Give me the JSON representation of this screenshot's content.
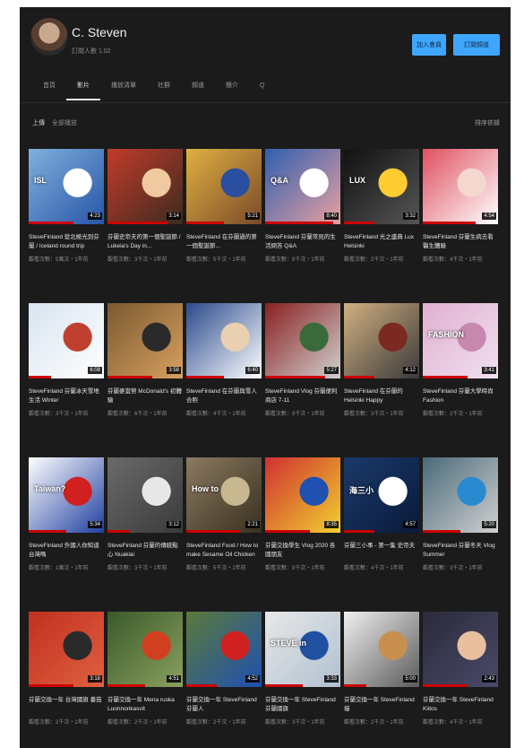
{
  "channel": {
    "name": "C. Steven",
    "subscribers": "訂閱人數 1.02",
    "join_button": "加入會員",
    "subscribe_button": "訂閱頻道"
  },
  "tabs": [
    {
      "label": "首頁"
    },
    {
      "label": "影片"
    },
    {
      "label": "播放清單"
    },
    {
      "label": "社群"
    },
    {
      "label": "頻道"
    },
    {
      "label": "簡介"
    },
    {
      "label": "Q"
    }
  ],
  "toolbar": {
    "left": "上傳",
    "left_sub": "全部播放",
    "right": "排序依據"
  },
  "videos": [
    {
      "title": "SteveFinland 從北極光到芬蘭 / Iceland round trip",
      "meta": "觀看次數：5萬次・1年前",
      "duration": "4:23",
      "progress": 0.6,
      "colors": [
        "#7fb0dc",
        "#ffffff",
        "#2855a8"
      ],
      "label": "ISL"
    },
    {
      "title": "芬蘭史帝夫的第一個聖誕節 / Lukeia's Day in...",
      "meta": "觀看次數：3千次・1年前",
      "duration": "3:14",
      "progress": 0.8,
      "colors": [
        "#c23b2a",
        "#f0c9a0",
        "#3b2b20"
      ],
      "label": ""
    },
    {
      "title": "SteveFinland 在芬蘭過的第一個聖誕節...",
      "meta": "觀看次數：5千次・1年前",
      "duration": "5:21",
      "progress": 0.5,
      "colors": [
        "#e0b040",
        "#2a4ea0",
        "#7a4a2a"
      ],
      "label": ""
    },
    {
      "title": "SteveFinland 芬蘭常見的生活問答 Q&A",
      "meta": "觀看次數：8千次・1年前",
      "duration": "8:40",
      "progress": 0.9,
      "colors": [
        "#2f5fb0",
        "#ffffff",
        "#e8a0a0"
      ],
      "label": "Q&A"
    },
    {
      "title": "SteveFinland 光之盛典 Lux Helsinki",
      "meta": "觀看次數：2千次・1年前",
      "duration": "3:32",
      "progress": 0.4,
      "colors": [
        "#111111",
        "#ffcc33",
        "#555555"
      ],
      "label": "LUX"
    },
    {
      "title": "SteveFinland 芬蘭生病去看醫生體驗",
      "meta": "觀看次數：4千次・1年前",
      "duration": "4:54",
      "progress": 0.7,
      "colors": [
        "#e05060",
        "#f4d8d0",
        "#ffffff"
      ],
      "label": ""
    },
    {
      "title": "SteveFinland 芬蘭冰天雪地生活 Winter",
      "meta": "觀看次數：3千次・1年前",
      "duration": "6:08",
      "progress": 0.3,
      "colors": [
        "#d8e4f0",
        "#c04030",
        "#ffffff"
      ],
      "label": ""
    },
    {
      "title": "芬蘭麥當勞 McDonald's 初體驗",
      "meta": "觀看次數：6千次・1年前",
      "duration": "3:58",
      "progress": 0.6,
      "colors": [
        "#7a5a30",
        "#2a2a2a",
        "#d8a060"
      ],
      "label": ""
    },
    {
      "title": "SteveFinland 在芬蘭與雪人合照",
      "meta": "觀看次數：4千次・1年前",
      "duration": "6:40",
      "progress": 0.5,
      "colors": [
        "#2a4a8a",
        "#e8d0b0",
        "#ffffff"
      ],
      "label": ""
    },
    {
      "title": "SteveFinland Vlog 芬蘭便利商店 7-11",
      "meta": "觀看次數：9千次・1年前",
      "duration": "5:27",
      "progress": 0.8,
      "colors": [
        "#8a2020",
        "#3a6a3a",
        "#d0d0d0"
      ],
      "label": ""
    },
    {
      "title": "SteveFinland 在芬蘭的 Helsinki Happy",
      "meta": "觀看次數：3千次・1年前",
      "duration": "4:12",
      "progress": 0.4,
      "colors": [
        "#d0b080",
        "#7a2a20",
        "#3a3a3a"
      ],
      "label": ""
    },
    {
      "title": "SteveFinland 芬蘭大學時尚 Fashion",
      "meta": "觀看次數：2千次・1年前",
      "duration": "3:41",
      "progress": 0.6,
      "colors": [
        "#e0b0d0",
        "#c888b0",
        "#f0e0f0"
      ],
      "label": "FASHION"
    },
    {
      "title": "SteveFinland 外國人你知道台灣嗎",
      "meta": "觀看次數：1萬次・1年前",
      "duration": "5:34",
      "progress": 0.5,
      "colors": [
        "#ffffff",
        "#d02020",
        "#2040a0"
      ],
      "label": "Taiwan?"
    },
    {
      "title": "SteveFinland 芬蘭的傳統點心 Nuakiai",
      "meta": "觀看次數：3千次・1年前",
      "duration": "3:12",
      "progress": 0.3,
      "colors": [
        "#6a6a6a",
        "#e8e8e8",
        "#3a3a3a"
      ],
      "label": ""
    },
    {
      "title": "SteveFinland Food / How to make Sesame Oil Chicken",
      "meta": "觀看次數：5千次・1年前",
      "duration": "2:21",
      "progress": 0.7,
      "colors": [
        "#8a7a60",
        "#c8b890",
        "#3a3020"
      ],
      "label": "How to"
    },
    {
      "title": "芬蘭交換學生 Vlog 2020 各國朋友",
      "meta": "觀看次數：8千次・1年前",
      "duration": "8:35",
      "progress": 0.6,
      "colors": [
        "#d03030",
        "#2050b0",
        "#f0d030"
      ],
      "label": ""
    },
    {
      "title": "芬蘭三小事 - 第一集 史帝夫",
      "meta": "觀看次數：4千次・1年前",
      "duration": "4:57",
      "progress": 0.4,
      "colors": [
        "#1a3a6a",
        "#ffffff",
        "#0a1a3a"
      ],
      "label": "海三小"
    },
    {
      "title": "SteveFinland 芬蘭冬天 Vlog Summer",
      "meta": "觀看次數：3千次・1年前",
      "duration": "5:20",
      "progress": 0.5,
      "colors": [
        "#4a6a7a",
        "#2a8ad0",
        "#d0d0d0"
      ],
      "label": ""
    },
    {
      "title": "芬蘭交換一年 台灣國旗 番茄",
      "meta": "觀看次數：2千次・1年前",
      "duration": "3:18",
      "progress": 0.6,
      "colors": [
        "#c03020",
        "#2a2a2a",
        "#e06040"
      ],
      "label": ""
    },
    {
      "title": "芬蘭交換一年 Mena ruska Luonnonkasvit",
      "meta": "觀看次數：2千次・1年前",
      "duration": "4:51",
      "progress": 0.5,
      "colors": [
        "#3a5a2a",
        "#d04020",
        "#8aa060"
      ],
      "label": ""
    },
    {
      "title": "芬蘭交換一年 SteveFinland 芬蘭人",
      "meta": "觀看次數：2千次・1年前",
      "duration": "4:52",
      "progress": 0.4,
      "colors": [
        "#5a7a3a",
        "#d02020",
        "#2050b0"
      ],
      "label": ""
    },
    {
      "title": "芬蘭交換一年 SteveFinland 芬蘭國旗",
      "meta": "觀看次數：3千次・1年前",
      "duration": "3:33",
      "progress": 0.5,
      "colors": [
        "#e8e8e8",
        "#2050a0",
        "#b0c0d0"
      ],
      "label": "STEVE in"
    },
    {
      "title": "芬蘭交換一年 SteveFinland 貓",
      "meta": "觀看次數：2千次・1年前",
      "duration": "5:00",
      "progress": 0.3,
      "colors": [
        "#f0f0f0",
        "#c89050",
        "#5a5a5a"
      ],
      "label": ""
    },
    {
      "title": "芬蘭交換一年 SteveFinland Kiitos",
      "meta": "觀看次數：4千次・1年前",
      "duration": "2:43",
      "progress": 0.6,
      "colors": [
        "#2a2a3a",
        "#e8c0a0",
        "#4a4a6a"
      ],
      "label": ""
    }
  ]
}
